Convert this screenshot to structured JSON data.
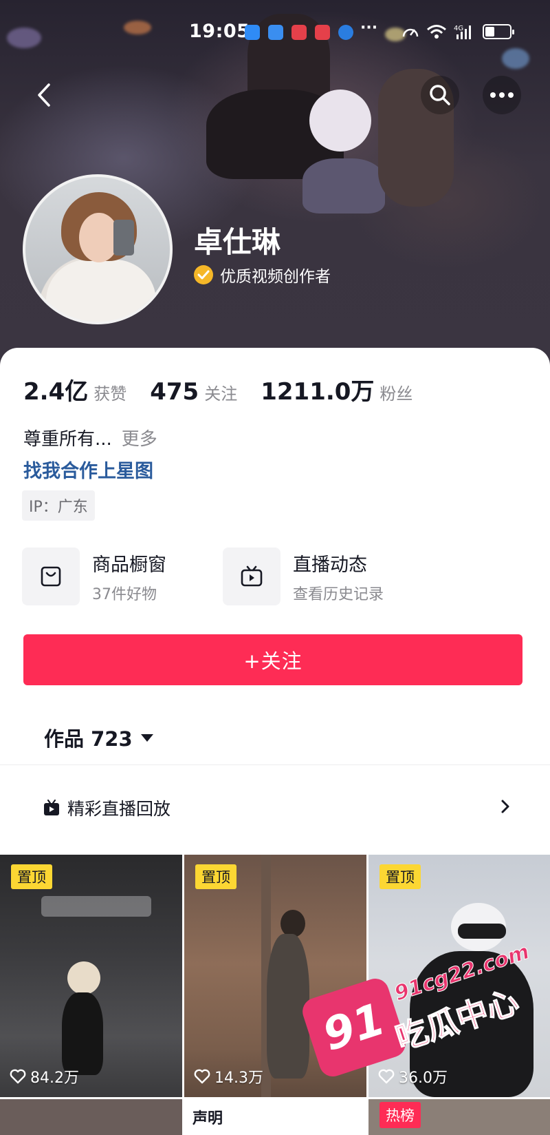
{
  "status_bar": {
    "time": "19:05",
    "network": "4G"
  },
  "profile": {
    "name": "卓仕琳",
    "badge": "优质视频创作者"
  },
  "stats": [
    {
      "value": "2.4亿",
      "label": "获赞"
    },
    {
      "value": "475",
      "label": "关注"
    },
    {
      "value": "1211.0万",
      "label": "粉丝"
    }
  ],
  "bio": {
    "text": "尊重所有...",
    "more": "更多"
  },
  "cooperation_link": "找我合作上星图",
  "ip_location": "IP：广东",
  "services": [
    {
      "title": "商品橱窗",
      "subtitle": "37件好物",
      "icon": "shopping-bag-icon"
    },
    {
      "title": "直播动态",
      "subtitle": "查看历史记录",
      "icon": "tv-icon"
    }
  ],
  "follow_button": "+关注",
  "works": {
    "label": "作品 723"
  },
  "live_replay": "精彩直播回放",
  "videos": [
    {
      "tag": "置顶",
      "likes": "84.2万"
    },
    {
      "tag": "置顶",
      "likes": "14.3万"
    },
    {
      "tag": "置顶",
      "likes": "36.0万"
    }
  ],
  "second_row": {
    "statement": "声明",
    "hot": "热榜"
  },
  "watermark": {
    "logo": "91",
    "url": "91cg22.com",
    "text": "吃瓜中心"
  },
  "colors": {
    "accent": "#fe2c55",
    "link": "#2a5b9c",
    "pin": "#fcd733",
    "verified": "#f5b728"
  }
}
